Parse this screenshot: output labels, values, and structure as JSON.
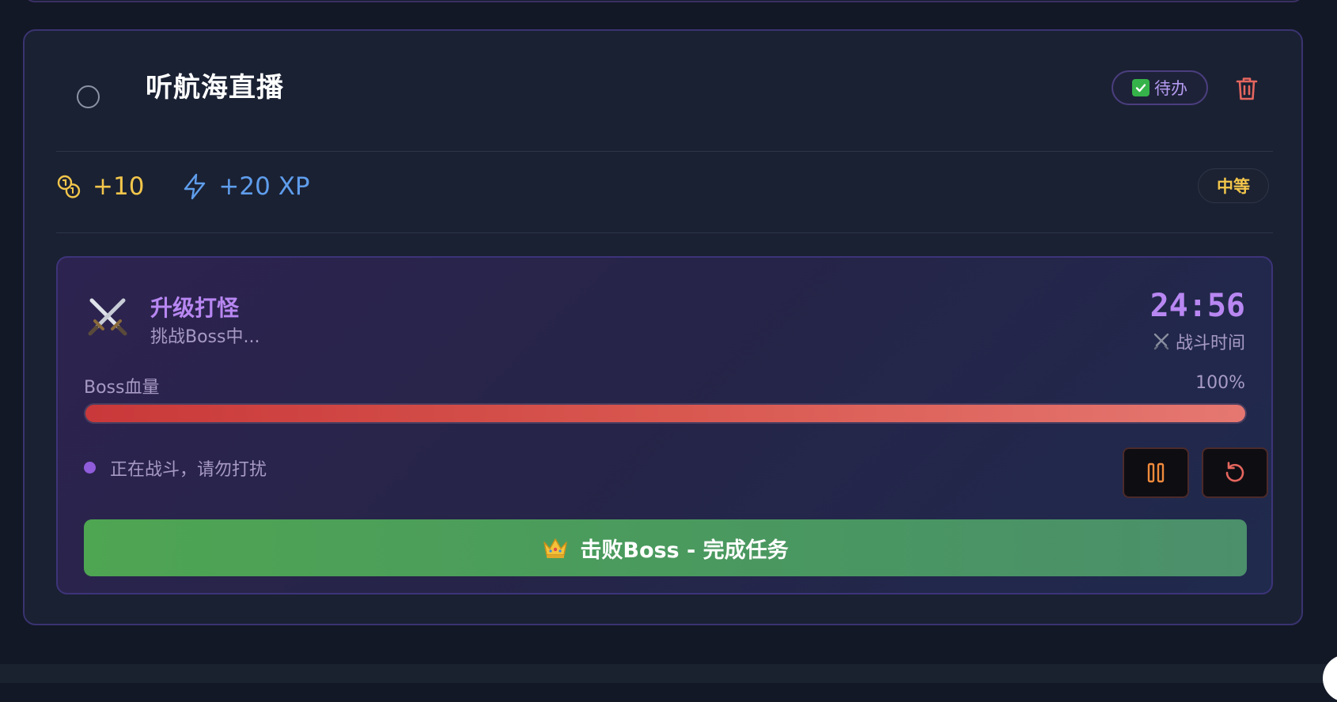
{
  "task": {
    "title": "听航海直播",
    "status_label": "待办",
    "difficulty": "中等",
    "rewards": {
      "coins": "+10",
      "xp": "+20 XP"
    }
  },
  "boss_mode": {
    "title": "升级打怪",
    "subtitle": "挑战Boss中...",
    "timer": "24:56",
    "timer_label": "战斗时间",
    "hp_label": "Boss血量",
    "hp_percent_text": "100%",
    "hp_value": 1.0,
    "status_text": "正在战斗，请勿打扰",
    "defeat_button_label": "击败Boss - 完成任务"
  },
  "icons": {
    "status": "check-box-icon",
    "delete": "trash-icon",
    "coins": "coins-icon",
    "xp": "lightning-icon",
    "mode": "crossed-swords-icon",
    "pause": "pause-icon",
    "reset": "rotate-ccw-icon",
    "defeat": "crown-icon"
  },
  "colors": {
    "accent_purple": "#b887f2",
    "coin_yellow": "#f3c64b",
    "xp_blue": "#5f9dec",
    "hp_red": "#d8574f",
    "success_green": "#4ea552",
    "delete_red": "#e5665e"
  }
}
